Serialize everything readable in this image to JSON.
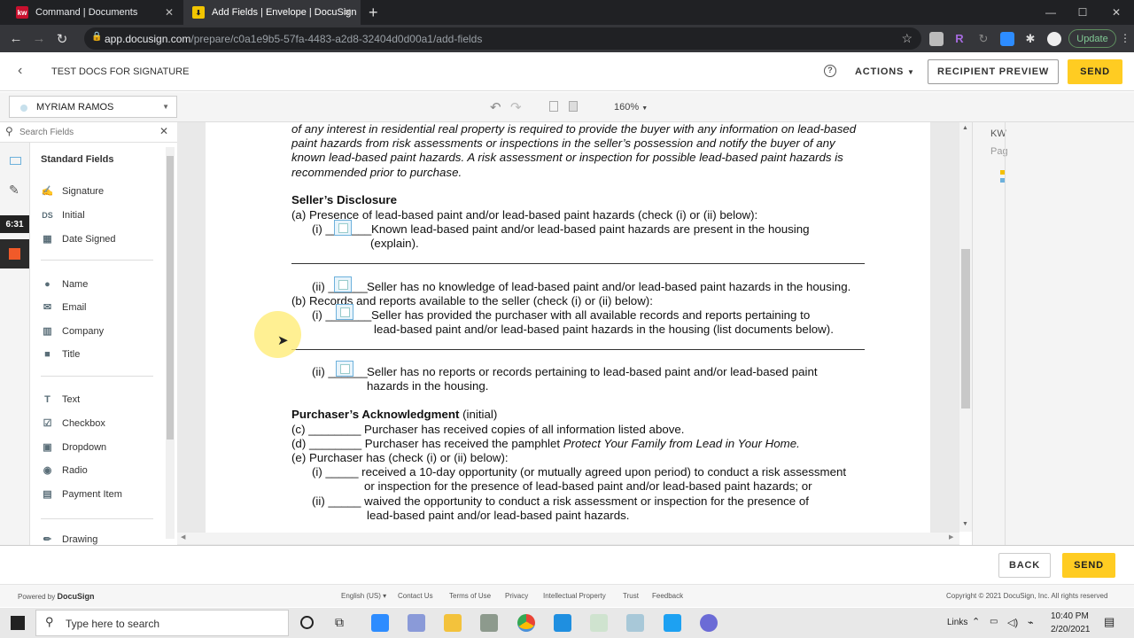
{
  "browser": {
    "tabs": [
      {
        "title": "Command | Documents",
        "favicon": "kw"
      },
      {
        "title": "Add Fields | Envelope | DocuSign",
        "favicon": "docusign-download-icon"
      }
    ],
    "new_tab": "+",
    "url_host": "app.docusign.com",
    "url_path": "/prepare/c0a1e9b5-57fa-4483-a2d8-32404d0d00a1/add-fields",
    "update_label": "Update"
  },
  "app": {
    "envelope_title": "TEST DOCS FOR SIGNATURE",
    "actions_label": "ACTIONS",
    "recipient_preview_label": "RECIPIENT PREVIEW",
    "send_label": "SEND",
    "recipient_name": "MYRIAM RAMOS",
    "zoom": "160%",
    "search_placeholder": "Search Fields",
    "standard_fields_title": "Standard Fields",
    "fields": [
      "Signature",
      "Initial",
      "Date Signed",
      "Name",
      "Email",
      "Company",
      "Title",
      "Text",
      "Checkbox",
      "Dropdown",
      "Radio",
      "Payment Item",
      "Drawing"
    ],
    "timer_label": "6:31",
    "right_panel_kw": "KW",
    "right_panel_pag": "Pag"
  },
  "document": {
    "intro": [
      "of any interest in residential real property is required to provide the buyer with any information on lead-based",
      "paint hazards from risk assessments or inspections in the seller’s possession and notify the buyer of any",
      "known lead-based paint hazards. A risk assessment or inspection for possible lead-based paint hazards is",
      "recommended prior to purchase."
    ],
    "seller_heading": "Seller’s Disclosure",
    "a_line": "(a) Presence of lead-based paint and/or lead-based paint hazards (check (i) or (ii) below):",
    "a_i_prefix": "(i) _______",
    "a_i_text1": "Known lead-based paint and/or lead-based paint hazards are present in the housing",
    "a_i_text2": "(explain).",
    "a_ii_prefix": "(ii) ______",
    "a_ii_text": "Seller has no knowledge of lead-based paint and/or lead-based paint hazards in the housing.",
    "b_line": "(b)  Records and reports available to the seller (check (i) or (ii) below):",
    "b_i_prefix": "(i) _______",
    "b_i_text1": "Seller has provided the purchaser with all available records and reports pertaining to",
    "b_i_text2": "lead-based paint and/or lead-based paint hazards in the housing (list documents below).",
    "b_ii_prefix": "(ii) ______",
    "b_ii_text1": "Seller has no reports or records pertaining to lead-based paint and/or lead-based paint",
    "b_ii_text2": "hazards in the housing.",
    "purchaser_heading": "Purchaser’s Acknowledgment",
    "purchaser_heading_suffix": " (initial)",
    "c_line": "(c) ________ Purchaser has received copies of all information listed above.",
    "d_line_pre": "(d) ________ Purchaser has received the pamphlet ",
    "d_line_italic": "Protect Your Family from Lead in Your Home.",
    "e_line": "(e) Purchaser has (check (i) or (ii) below):",
    "e_i_1": "(i) _____  received a 10-day opportunity (or mutually agreed upon period) to conduct a risk assessment",
    "e_i_2": "or inspection for the presence of lead-based paint and/or lead-based paint hazards; or",
    "e_ii_1": "(ii) _____  waived the opportunity to conduct a risk assessment or inspection for the presence of",
    "e_ii_2": "lead-based paint and/or lead-based paint hazards."
  },
  "footer_actions": {
    "back": "BACK",
    "send": "SEND"
  },
  "footer": {
    "powered_by": "Powered by",
    "brand": "DocuSign",
    "language": "English (US)",
    "links": [
      "Contact Us",
      "Terms of Use",
      "Privacy",
      "Intellectual Property",
      "Trust",
      "Feedback"
    ],
    "copyright": "Copyright © 2021 DocuSign, Inc. All rights reserved"
  },
  "taskbar": {
    "search_placeholder": "Type here to search",
    "links_label": "Links",
    "time": "10:40 PM",
    "date": "2/20/2021"
  }
}
